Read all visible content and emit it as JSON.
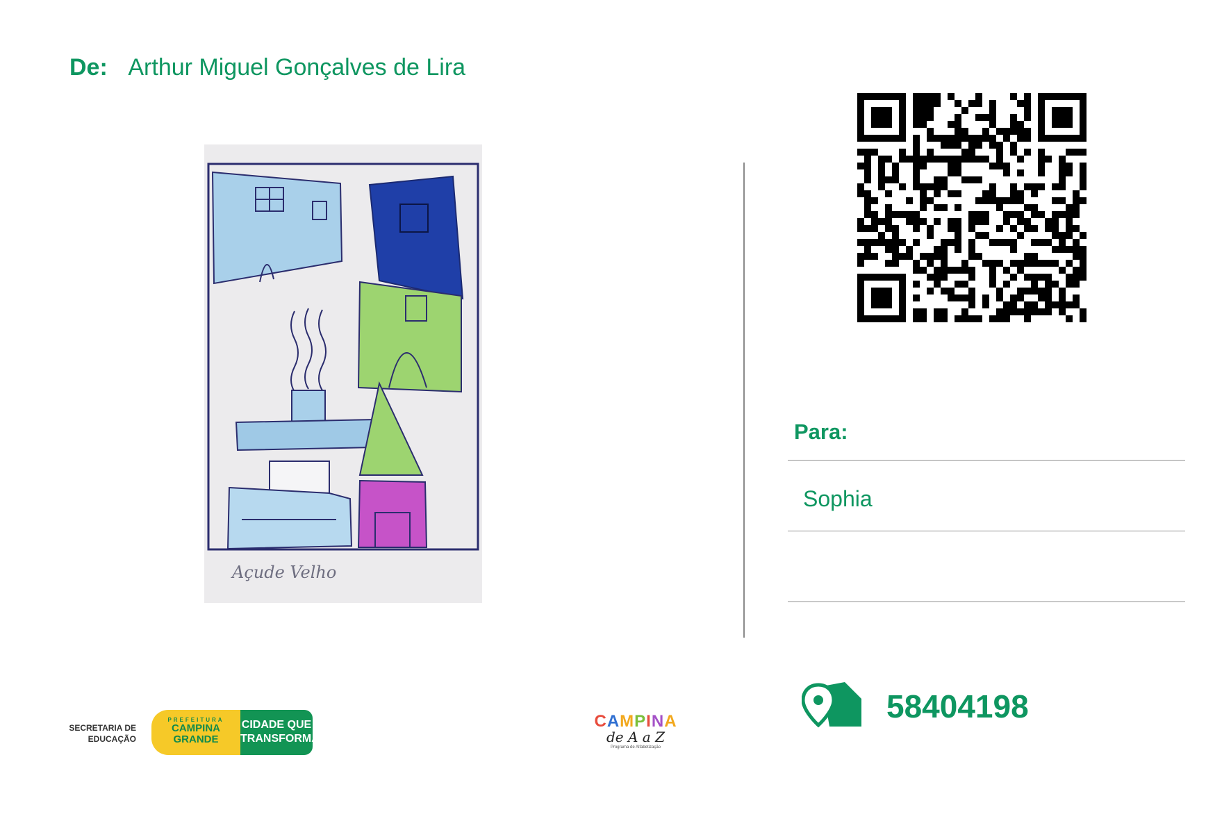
{
  "header": {
    "from_label": "De:",
    "from_name": "Arthur Miguel Gonçalves de Lira"
  },
  "drawing": {
    "caption": "Açude Velho"
  },
  "recipient": {
    "to_label": "Para:",
    "to_name": "Sophia"
  },
  "postal": {
    "code": "58404198",
    "icon": "location-house-icon"
  },
  "footer": {
    "secretaria": "SECRETARIA DE EDUCAÇÃO",
    "prefeitura_top": "PREFEITURA",
    "prefeitura_name": "CAMPINA GRANDE",
    "slogan": "CIDADE QUE TRANSFORMA",
    "program_title": "CAMPINA",
    "program_sub": "de A a Z",
    "program_tag": "Programa de Alfabetização"
  },
  "colors": {
    "accent": "#0e9660",
    "yellow": "#f6c928",
    "dark_green": "#129454"
  }
}
